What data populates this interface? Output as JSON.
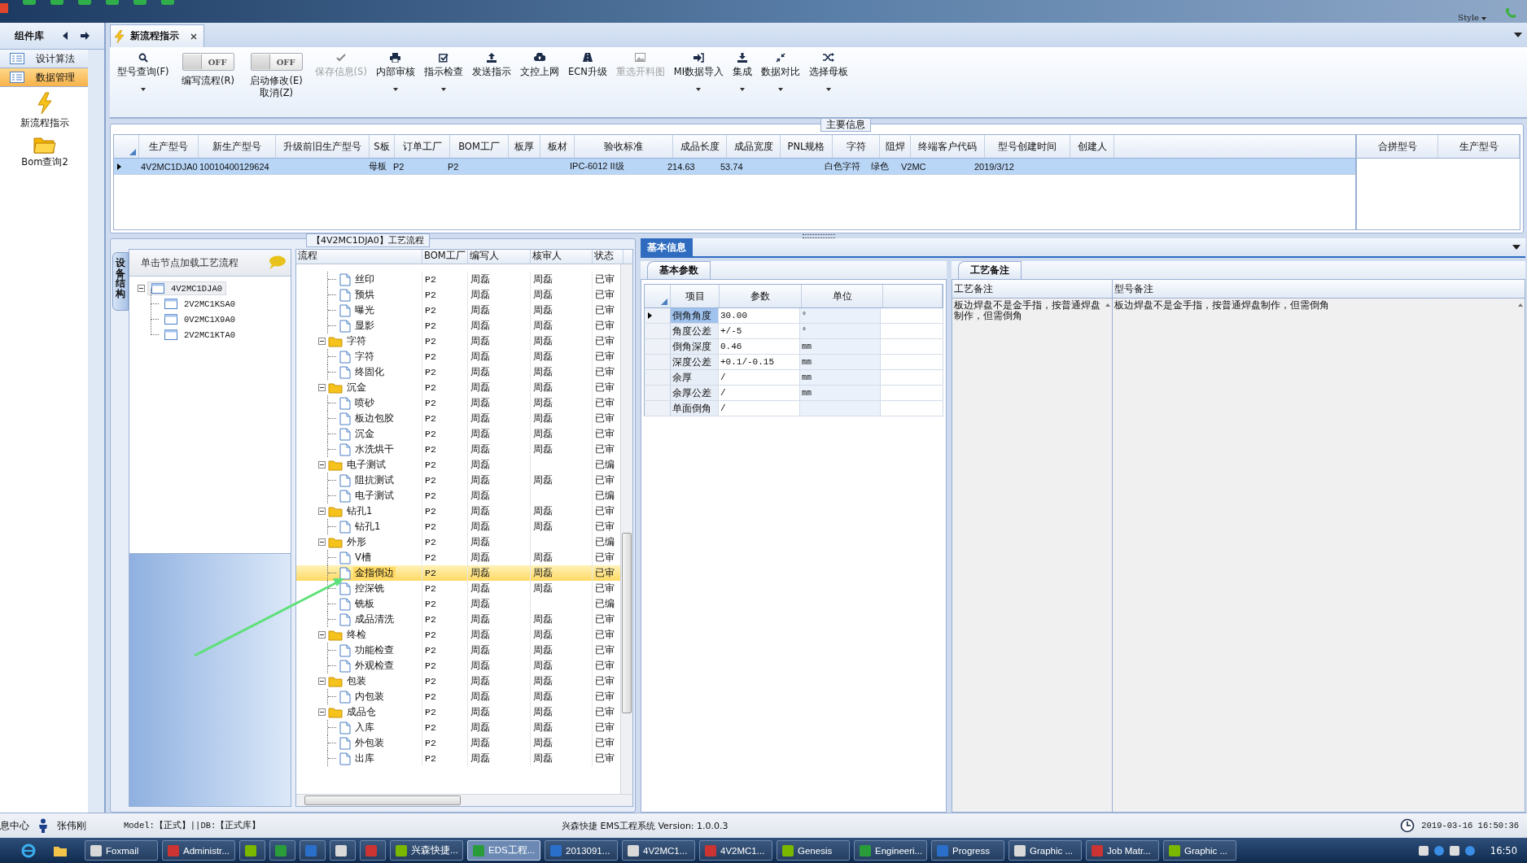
{
  "app_bar": {
    "style_menu": "Style"
  },
  "sidebar": {
    "title": "组件库",
    "categories": [
      {
        "label": "设计算法",
        "selected": false
      },
      {
        "label": "数据管理",
        "selected": true
      }
    ],
    "tools": [
      {
        "label": "新流程指示"
      },
      {
        "label": "Bom查询2"
      }
    ]
  },
  "tabs": [
    {
      "label": "新流程指示",
      "selected": true
    }
  ],
  "toolbar": [
    {
      "kind": "button",
      "label": "型号查询(F)",
      "dropdown": true,
      "disabled": false
    },
    {
      "kind": "toggle",
      "label": "编写流程(R)",
      "on": false,
      "state_text": "OFF"
    },
    {
      "kind": "toggle",
      "label": "启动修改(E)",
      "label2": "取消(Z)",
      "on": false,
      "state_text": "OFF"
    },
    {
      "kind": "button",
      "label": "保存信息(S)",
      "dropdown": false,
      "disabled": true
    },
    {
      "kind": "button",
      "label": "内部审核",
      "dropdown": true,
      "disabled": false
    },
    {
      "kind": "button",
      "label": "指示检查",
      "dropdown": true,
      "disabled": false
    },
    {
      "kind": "button",
      "label": "发送指示",
      "dropdown": false,
      "disabled": false
    },
    {
      "kind": "button",
      "label": "文控上网",
      "dropdown": false,
      "disabled": false
    },
    {
      "kind": "button",
      "label": "ECN升级",
      "dropdown": false,
      "disabled": false
    },
    {
      "kind": "button",
      "label": "重选开料图",
      "dropdown": false,
      "disabled": true
    },
    {
      "kind": "button",
      "label": "MI数据导入",
      "dropdown": true,
      "disabled": false
    },
    {
      "kind": "button",
      "label": "集成",
      "dropdown": true,
      "disabled": false
    },
    {
      "kind": "button",
      "label": "数据对比",
      "dropdown": true,
      "disabled": false
    },
    {
      "kind": "button",
      "label": "选择母板",
      "dropdown": true,
      "disabled": false
    }
  ],
  "main_info": {
    "title": "主要信息",
    "columns": [
      "生产型号",
      "新生产型号",
      "升级前旧生产型号",
      "S板",
      "订单工厂",
      "BOM工厂",
      "板厚",
      "板材",
      "验收标准",
      "成品长度",
      "成品宽度",
      "PNL规格",
      "字符",
      "阻焊",
      "终端客户代码",
      "型号创建时间",
      "创建人"
    ],
    "rows": [
      {
        "selected": true,
        "cells": [
          "4V2MC1DJA0",
          "10010400129624",
          null,
          "母板",
          "P2",
          "P2",
          null,
          null,
          "IPC-6012 II级",
          "214.63",
          "53.74",
          null,
          "白色字符",
          "绿色",
          "V2MC",
          "2019/3/12",
          null
        ]
      }
    ],
    "merge_columns": [
      "合拼型号",
      "生产型号"
    ]
  },
  "process_panel": {
    "title": "【4V2MC1DJA0】工艺流程",
    "side_tab": "设备结构",
    "tree_hint": "单击节点加载工艺流程",
    "tree": [
      {
        "label": "4V2MC1DJA0",
        "selected": true,
        "expanded": true,
        "children": [
          {
            "label": "2V2MC1KSA0",
            "selected": false
          },
          {
            "label": "0V2MC1X9A0",
            "selected": false
          },
          {
            "label": "2V2MC1KTA0",
            "selected": false
          }
        ]
      }
    ],
    "columns": [
      "流程",
      "BOM工厂",
      "编写人",
      "核审人",
      "状态"
    ],
    "rows": [
      {
        "kind": "step",
        "name": "丝印",
        "bom": "P2",
        "writer": "周磊",
        "reviewer": "周磊",
        "status": "已审",
        "selected": false
      },
      {
        "kind": "step",
        "name": "预烘",
        "bom": "P2",
        "writer": "周磊",
        "reviewer": "周磊",
        "status": "已审",
        "selected": false
      },
      {
        "kind": "step",
        "name": "曝光",
        "bom": "P2",
        "writer": "周磊",
        "reviewer": "周磊",
        "status": "已审",
        "selected": false
      },
      {
        "kind": "step",
        "name": "显影",
        "bom": "P2",
        "writer": "周磊",
        "reviewer": "周磊",
        "status": "已审",
        "selected": false
      },
      {
        "kind": "folder",
        "name": "字符",
        "bom": "P2",
        "writer": "周磊",
        "reviewer": "周磊",
        "status": "已审",
        "selected": false,
        "expanded": true,
        "children": [
          {
            "kind": "step",
            "name": "字符",
            "bom": "P2",
            "writer": "周磊",
            "reviewer": "周磊",
            "status": "已审",
            "selected": false
          },
          {
            "kind": "step",
            "name": "终固化",
            "bom": "P2",
            "writer": "周磊",
            "reviewer": "周磊",
            "status": "已审",
            "selected": false
          }
        ]
      },
      {
        "kind": "folder",
        "name": "沉金",
        "bom": "P2",
        "writer": "周磊",
        "reviewer": "周磊",
        "status": "已审",
        "selected": false,
        "expanded": true,
        "children": [
          {
            "kind": "step",
            "name": "喷砂",
            "bom": "P2",
            "writer": "周磊",
            "reviewer": "周磊",
            "status": "已审",
            "selected": false
          },
          {
            "kind": "step",
            "name": "板边包胶",
            "bom": "P2",
            "writer": "周磊",
            "reviewer": "周磊",
            "status": "已审",
            "selected": false
          },
          {
            "kind": "step",
            "name": "沉金",
            "bom": "P2",
            "writer": "周磊",
            "reviewer": "周磊",
            "status": "已审",
            "selected": false
          },
          {
            "kind": "step",
            "name": "水洗烘干",
            "bom": "P2",
            "writer": "周磊",
            "reviewer": "周磊",
            "status": "已审",
            "selected": false
          }
        ]
      },
      {
        "kind": "folder",
        "name": "电子测试",
        "bom": "P2",
        "writer": "周磊",
        "status": "已编",
        "selected": false,
        "expanded": true,
        "children": [
          {
            "kind": "step",
            "name": "阻抗测试",
            "bom": "P2",
            "writer": "周磊",
            "reviewer": "周磊",
            "status": "已审",
            "selected": false
          },
          {
            "kind": "step",
            "name": "电子测试",
            "bom": "P2",
            "writer": "周磊",
            "status": "已编",
            "selected": false
          }
        ]
      },
      {
        "kind": "folder",
        "name": "钻孔1",
        "bom": "P2",
        "writer": "周磊",
        "reviewer": "周磊",
        "status": "已审",
        "selected": false,
        "expanded": true,
        "children": [
          {
            "kind": "step",
            "name": "钻孔1",
            "bom": "P2",
            "writer": "周磊",
            "reviewer": "周磊",
            "status": "已审",
            "selected": false
          }
        ]
      },
      {
        "kind": "folder",
        "name": "外形",
        "bom": "P2",
        "writer": "周磊",
        "status": "已编",
        "selected": false,
        "expanded": true,
        "children": [
          {
            "kind": "step",
            "name": "V槽",
            "bom": "P2",
            "writer": "周磊",
            "reviewer": "周磊",
            "status": "已审",
            "selected": false
          },
          {
            "kind": "step",
            "name": "金指倒边",
            "bom": "P2",
            "writer": "周磊",
            "reviewer": "周磊",
            "status": "已审",
            "selected": true
          },
          {
            "kind": "step",
            "name": "控深铣",
            "bom": "P2",
            "writer": "周磊",
            "reviewer": "周磊",
            "status": "已审",
            "selected": false
          },
          {
            "kind": "step",
            "name": "铣板",
            "bom": "P2",
            "writer": "周磊",
            "status": "已编",
            "selected": false
          },
          {
            "kind": "step",
            "name": "成品清洗",
            "bom": "P2",
            "writer": "周磊",
            "reviewer": "周磊",
            "status": "已审",
            "selected": false
          }
        ]
      },
      {
        "kind": "folder",
        "name": "终检",
        "bom": "P2",
        "writer": "周磊",
        "reviewer": "周磊",
        "status": "已审",
        "selected": false,
        "expanded": true,
        "children": [
          {
            "kind": "step",
            "name": "功能检查",
            "bom": "P2",
            "writer": "周磊",
            "reviewer": "周磊",
            "status": "已审",
            "selected": false
          },
          {
            "kind": "step",
            "name": "外观检查",
            "bom": "P2",
            "writer": "周磊",
            "reviewer": "周磊",
            "status": "已审",
            "selected": false
          }
        ]
      },
      {
        "kind": "folder",
        "name": "包装",
        "bom": "P2",
        "writer": "周磊",
        "reviewer": "周磊",
        "status": "已审",
        "selected": false,
        "expanded": true,
        "children": [
          {
            "kind": "step",
            "name": "内包装",
            "bom": "P2",
            "writer": "周磊",
            "reviewer": "周磊",
            "status": "已审",
            "selected": false
          }
        ]
      },
      {
        "kind": "folder",
        "name": "成品仓",
        "bom": "P2",
        "writer": "周磊",
        "reviewer": "周磊",
        "status": "已审",
        "selected": false,
        "expanded": true,
        "children": [
          {
            "kind": "step",
            "name": "入库",
            "bom": "P2",
            "writer": "周磊",
            "reviewer": "周磊",
            "status": "已审",
            "selected": false
          },
          {
            "kind": "step",
            "name": "外包装",
            "bom": "P2",
            "writer": "周磊",
            "reviewer": "周磊",
            "status": "已审",
            "selected": false
          },
          {
            "kind": "step",
            "name": "出库",
            "bom": "P2",
            "writer": "周磊",
            "reviewer": "周磊",
            "status": "已审",
            "selected": false
          }
        ]
      }
    ]
  },
  "basic_info": {
    "tab": "基本信息",
    "params": {
      "tab": "基本参数",
      "columns": [
        "项目",
        "参数",
        "单位"
      ],
      "rows": [
        {
          "item": "倒角角度",
          "value": "30.00",
          "unit": "°",
          "selected": true
        },
        {
          "item": "角度公差",
          "value": "+/-5",
          "unit": "°",
          "selected": false
        },
        {
          "item": "倒角深度",
          "value": "0.46",
          "unit": "mm",
          "selected": false
        },
        {
          "item": "深度公差",
          "value": "+0.1/-0.15",
          "unit": "mm",
          "selected": false
        },
        {
          "item": "余厚",
          "value": "/",
          "unit": "mm",
          "selected": false
        },
        {
          "item": "余厚公差",
          "value": "/",
          "unit": "mm",
          "selected": false
        },
        {
          "item": "单面倒角",
          "value": "/",
          "selected": false
        }
      ]
    },
    "notes": {
      "tab": "工艺备注",
      "columns": [
        "工艺备注",
        "型号备注"
      ],
      "process_note": "板边焊盘不是金手指，按普通焊盘制作，但需倒角",
      "model_note": "板边焊盘不是金手指，按普通焊盘制作，但需倒角"
    }
  },
  "status_bar": {
    "info_center": "息中心",
    "user": "张伟刚",
    "env": "Model:【正式】||DB:【正式库】",
    "system": "兴森快捷 EMS工程系统 Version: 1.0.0.3",
    "datetime": "2019-03-16 16:50:36"
  },
  "taskbar": {
    "items": [
      {
        "kind": "app",
        "label": "Foxmail",
        "selected": false
      },
      {
        "kind": "app",
        "label": "Administr...",
        "selected": false
      },
      {
        "kind": "icon",
        "selected": false
      },
      {
        "kind": "icon",
        "selected": false
      },
      {
        "kind": "icon",
        "selected": false
      },
      {
        "kind": "icon",
        "selected": false
      },
      {
        "kind": "icon",
        "selected": false
      },
      {
        "kind": "app",
        "label": "兴森快捷...",
        "selected": false
      },
      {
        "kind": "app",
        "label": "EDS工程...",
        "selected": true
      },
      {
        "kind": "app",
        "label": "2013091...",
        "selected": false
      },
      {
        "kind": "app",
        "label": "4V2MC1...",
        "selected": false
      },
      {
        "kind": "app",
        "label": "4V2MC1...",
        "selected": false
      },
      {
        "kind": "app",
        "label": "Genesis",
        "selected": false
      },
      {
        "kind": "app",
        "label": "Engineeri...",
        "selected": false
      },
      {
        "kind": "app",
        "label": "Progress",
        "selected": false
      },
      {
        "kind": "app",
        "label": "Graphic ...",
        "selected": false
      },
      {
        "kind": "app",
        "label": "Job Matr...",
        "selected": false
      },
      {
        "kind": "app",
        "label": "Graphic ...",
        "selected": false
      }
    ],
    "clock": "16:50"
  }
}
